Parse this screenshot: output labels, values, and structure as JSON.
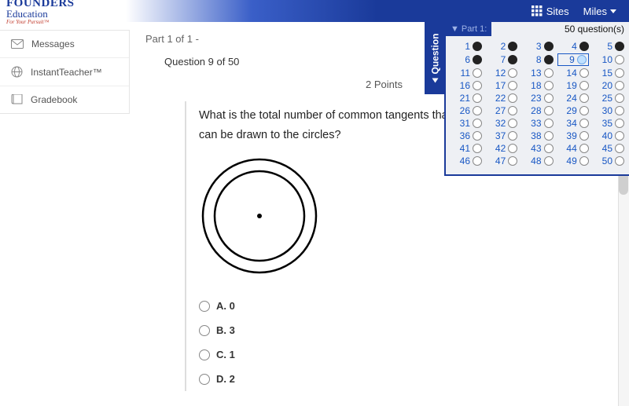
{
  "header": {
    "logo_line1": "FOUNDERS",
    "logo_line2": "Education",
    "logo_tagline": "For Your Pursuit™",
    "sites_label": "Sites",
    "user_name": "Miles"
  },
  "sidebar": {
    "items": [
      {
        "label": "Messages",
        "icon": "envelope-icon"
      },
      {
        "label": "InstantTeacher™",
        "icon": "globe-icon"
      },
      {
        "label": "Gradebook",
        "icon": "book-icon"
      }
    ]
  },
  "quiz": {
    "part_label": "Part 1 of 1 -",
    "question_label": "Question 9 of 50",
    "points_label": "2 Points",
    "question_text": "What is the total number of common tangents that can be drawn to the circles?",
    "answers": [
      {
        "key": "A",
        "text": "A. 0"
      },
      {
        "key": "B",
        "text": "B. 3"
      },
      {
        "key": "C",
        "text": "C. 1"
      },
      {
        "key": "D",
        "text": "D. 2"
      }
    ]
  },
  "navigator": {
    "tab_label": "Question",
    "section_label": "Part 1:",
    "count_label": "50 question(s)",
    "total": 50,
    "answered": [
      1,
      2,
      3,
      4,
      5,
      6,
      7,
      8
    ],
    "current": 9
  }
}
